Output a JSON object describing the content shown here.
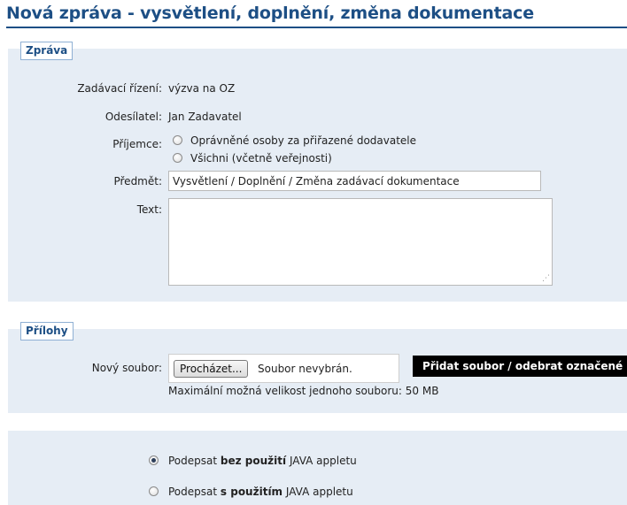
{
  "header": {
    "title": "Nová zpráva - vysvětlení, doplnění, změna dokumentace"
  },
  "message_section": {
    "legend": "Zpráva",
    "procurement_label": "Zadávací řízení:",
    "procurement_value": "výzva na OZ",
    "sender_label": "Odesílatel:",
    "sender_value": "Jan Zadavatel",
    "recipient_label": "Příjemce:",
    "recipient_options": [
      {
        "label": "Oprávněné osoby za přiřazené dodavatele",
        "checked": false
      },
      {
        "label": "Všichni (včetně veřejnosti)",
        "checked": false
      }
    ],
    "subject_label": "Předmět:",
    "subject_value": "Vysvětlení / Doplnění / Změna zadávací dokumentace",
    "text_label": "Text:",
    "text_value": ""
  },
  "attachments_section": {
    "legend": "Přílohy",
    "file_label": "Nový soubor:",
    "browse_label": "Procházet...",
    "file_status": "Soubor nevybrán.",
    "add_remove_label": "Přidat soubor / odebrat označené",
    "max_size_note": "Maximální možná velikost jednoho souboru: 50 MB"
  },
  "sign_section": {
    "options": [
      {
        "prefix": "Podepsat ",
        "bold": "bez použití",
        "suffix": " JAVA appletu",
        "checked": true
      },
      {
        "prefix": "Podepsat ",
        "bold": "s použitím",
        "suffix": " JAVA appletu",
        "checked": false
      }
    ]
  }
}
